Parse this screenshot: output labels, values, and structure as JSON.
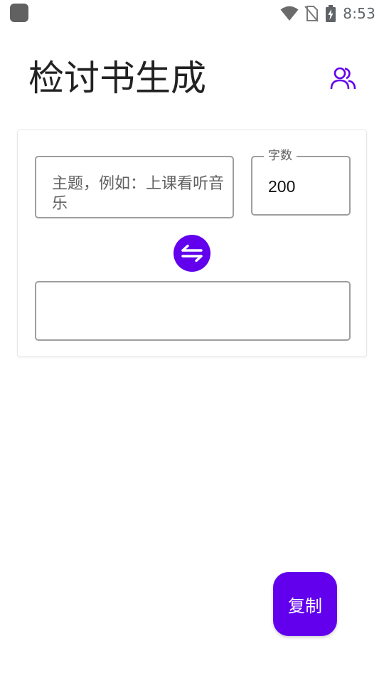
{
  "status_bar": {
    "time": "8:53",
    "icons": [
      "app-notification-icon",
      "wifi-icon",
      "no-sim-icon",
      "battery-charging-icon"
    ]
  },
  "header": {
    "title": "检讨书生成",
    "action_icon": "users-icon"
  },
  "form": {
    "topic_placeholder": "主题，例如：上课看听音乐",
    "topic_value": "",
    "word_count_label": "字数",
    "word_count_value": "200",
    "swap_icon": "swap-arrows-icon",
    "output_value": ""
  },
  "fab": {
    "copy_label": "复制"
  },
  "colors": {
    "accent": "#6200ee",
    "border": "#9e9e9e",
    "placeholder": "#616161"
  }
}
